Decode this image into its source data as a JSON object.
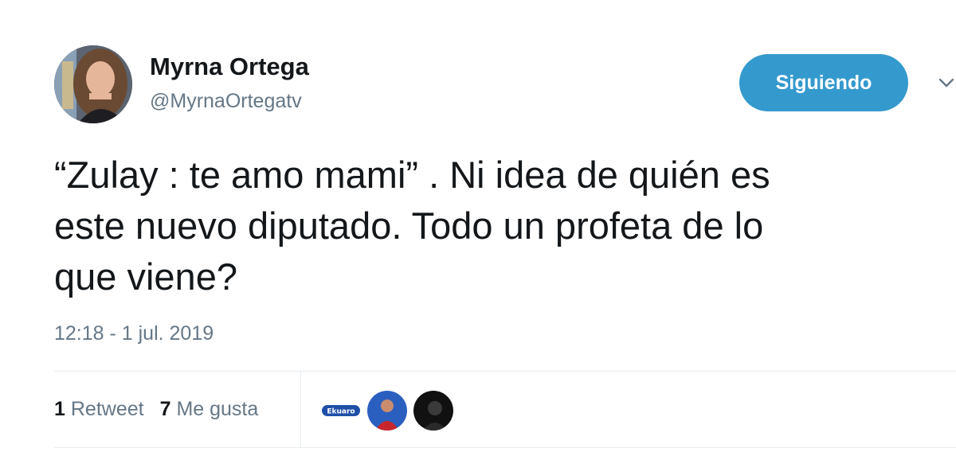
{
  "user": {
    "name": "Myrna Ortega",
    "handle": "@MyrnaOrtegatv"
  },
  "follow_button": {
    "label": "Siguiendo",
    "color": "#3499cd"
  },
  "tweet": {
    "lines": [
      "“Zulay : te amo mami” . Ni idea de quién es",
      "este nuevo diputado. Todo un profeta de lo",
      "que viene?"
    ],
    "timestamp": "12:18 - 1 jul. 2019"
  },
  "stats": {
    "retweets_count": "1",
    "retweets_label": "Retweet",
    "likes_count": "7",
    "likes_label": "Me gusta"
  },
  "likers": [
    {
      "icon": "liker-logo-avatar",
      "text": "Ekuaro"
    },
    {
      "icon": "liker-red-shirt-avatar"
    },
    {
      "icon": "liker-dark-avatar"
    }
  ],
  "icons": {
    "more": "chevron-down-icon"
  },
  "colors": {
    "text": "#14171a",
    "secondary": "#657786",
    "divider": "#e6ecf0"
  }
}
